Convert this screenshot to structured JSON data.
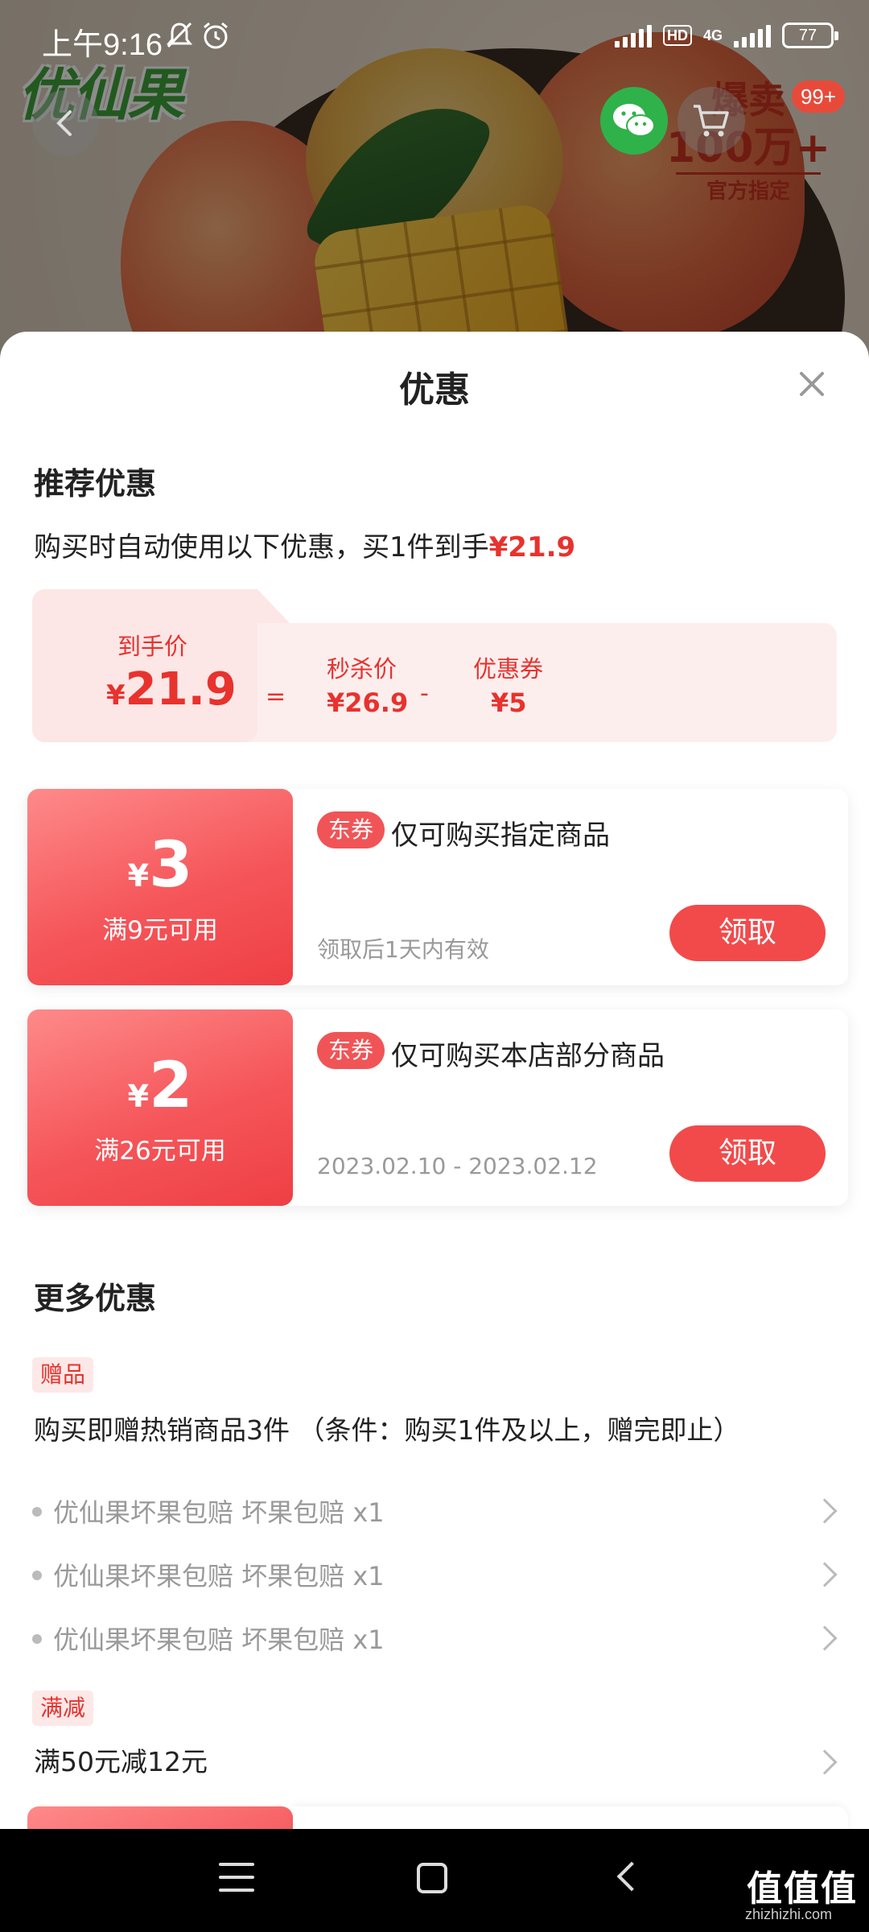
{
  "status_bar": {
    "time": "上午9:16",
    "hd_label": "HD",
    "network": "4G",
    "battery": "77"
  },
  "hero": {
    "brand_text": "优仙果",
    "hot_line1": "爆卖",
    "hot_line2": "100万+",
    "hot_line3": "官方指定",
    "cart_count": "99+"
  },
  "sheet": {
    "title": "优惠",
    "close_icon": "close-icon"
  },
  "recommended": {
    "title": "推荐优惠",
    "desc_prefix": "购买时自动使用以下优惠，买1件到手",
    "desc_price": "¥21.9",
    "final_label": "到手价",
    "final_currency": "¥",
    "final_value": "21.9",
    "equals": "=",
    "flash_label": "秒杀价",
    "flash_value": "¥26.9",
    "minus": "-",
    "coupon_label": "优惠券",
    "coupon_value": "¥5"
  },
  "coupons": [
    {
      "currency": "¥",
      "amount": "3",
      "condition": "满9元可用",
      "tag": "东券",
      "description": "仅可购买指定商品",
      "validity": "领取后1天内有效",
      "button": "领取"
    },
    {
      "currency": "¥",
      "amount": "2",
      "condition": "满26元可用",
      "tag": "东券",
      "description": "仅可购买本店部分商品",
      "validity": "2023.02.10 - 2023.02.12",
      "button": "领取"
    }
  ],
  "more": {
    "title": "更多优惠",
    "gift_tag": "赠品",
    "gift_desc": "购买即赠热销商品3件 （条件：购买1件及以上，赠完即止）",
    "gift_items": [
      "优仙果坏果包赔 坏果包赔 x1",
      "优仙果坏果包赔 坏果包赔 x1",
      "优仙果坏果包赔 坏果包赔 x1"
    ],
    "discount_tag": "满减",
    "discount_desc": "满50元减12元"
  },
  "watermark": {
    "text": "值值值",
    "url": "zhizhizhi.com"
  },
  "colors": {
    "accent": "#e8322d",
    "coupon_gradient_start": "#fe8a8a",
    "coupon_gradient_end": "#ee3f44",
    "wechat": "#2fb24a"
  }
}
